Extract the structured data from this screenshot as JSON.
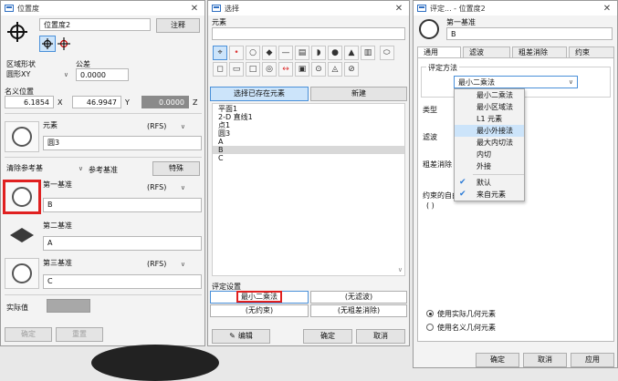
{
  "win1": {
    "title": "位置度",
    "name_value": "位置度2",
    "note_button": "注释",
    "zone_shape_label": "区域形状",
    "zone_shape_value": "圆形XY",
    "tolerance_label": "公差",
    "tolerance_value": "0.0000",
    "nominal_label": "名义位置",
    "x_value": "6.1854",
    "x_label": "X",
    "y_value": "46.9947",
    "y_label": "Y",
    "z_value": "0.0000",
    "z_label": "Z",
    "element_label": "元素",
    "element_rfs": "(RFS)",
    "element_value": "圆3",
    "clear_ref_combo": "清除参考基",
    "ref_datum_label": "参考基准",
    "special_button": "特殊",
    "datum1_label": "第一基准",
    "datum1_rfs": "(RFS)",
    "datum1_value": "B",
    "datum2_label": "第二基准",
    "datum2_value": "A",
    "datum3_label": "第三基准",
    "datum3_rfs": "(RFS)",
    "datum3_value": "C",
    "actual_label": "实际值",
    "ok_button": "确定",
    "reset_button": "重置"
  },
  "win2": {
    "title": "选择",
    "element_label": "元素",
    "select_existing_tab": "选择已存在元素",
    "new_tab": "新建",
    "list": [
      "平面1",
      "2-D 直线1",
      "点1",
      "圆3",
      "A",
      "B",
      "C"
    ],
    "selected_index": 5,
    "eval_settings_label": "评定设置",
    "eval_min_squares": "最小二乘法",
    "eval_no_filter": "(无滤波)",
    "eval_no_constraint": "(无约束)",
    "eval_no_outlier": "(无粗差消除)",
    "edit_button": "编辑",
    "ok_button": "确定",
    "cancel_button": "取消"
  },
  "win3": {
    "title": "评定... - 位置度2",
    "datum_label": "第一基准",
    "datum_value": "B",
    "tabs": [
      "通用",
      "滤波",
      "粗差消除",
      "约束"
    ],
    "method_group": "评定方法",
    "method_value": "最小二乘法",
    "type_label": "类型",
    "filter_label": "滤波",
    "outlier_label": "粗差消除",
    "constraint_label": "约束的自由",
    "constraint_value": "( )",
    "menu_items": [
      "最小二乘法",
      "最小区域法",
      "L1 元素",
      "最小外接法",
      "最大内切法",
      "内切",
      "外接"
    ],
    "menu_highlight_index": 3,
    "menu_checks": [
      "默认",
      "来自元素"
    ],
    "radio_actual": "使用实际几何元素",
    "radio_nominal": "使用名义几何元素",
    "ok_button": "确定",
    "cancel_button": "取消",
    "apply_button": "应用"
  },
  "colors": {
    "accent_red": "#e02020",
    "highlight": "#cce4fa",
    "menu_check": "#2a7ad6"
  }
}
